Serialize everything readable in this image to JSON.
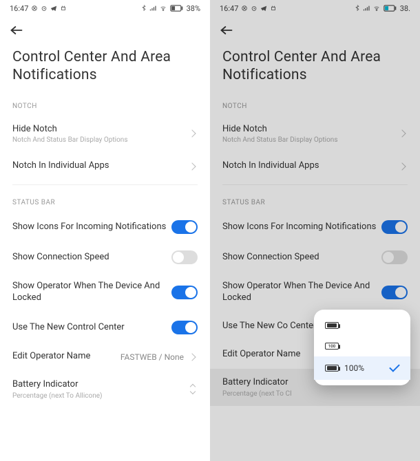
{
  "status": {
    "time": "16:47",
    "battery": "38%",
    "battery_right": "38."
  },
  "title": "Control Center And Area Notifications",
  "sections": {
    "notch": {
      "label": "NOTCH",
      "hide_notch": {
        "title": "Hide Notch",
        "sub": "Notch And Status Bar Display Options"
      },
      "individual": {
        "title": "Notch In Individual Apps"
      }
    },
    "status_bar": {
      "label": "STATUS BAR",
      "icons_notif": {
        "title": "Show Icons For Incoming Notifications"
      },
      "conn_speed": {
        "title": "Show Connection Speed"
      },
      "operator_lock": {
        "title": "Show Operator When The Device And Locked"
      },
      "new_cc": {
        "title": "Use The New Control Center"
      },
      "new_cc_short": {
        "title": "Use The New Co Center"
      },
      "edit_op": {
        "title": "Edit Operator Name",
        "value": "FASTWEB / None"
      },
      "batt_ind": {
        "title": "Battery Indicator",
        "sub": "Percentage (next To Allicone)"
      },
      "batt_ind_r": {
        "title": "Battery Indicator",
        "sub": "Percentage (next To CI"
      }
    }
  },
  "popup": {
    "pct_label": "100%"
  }
}
